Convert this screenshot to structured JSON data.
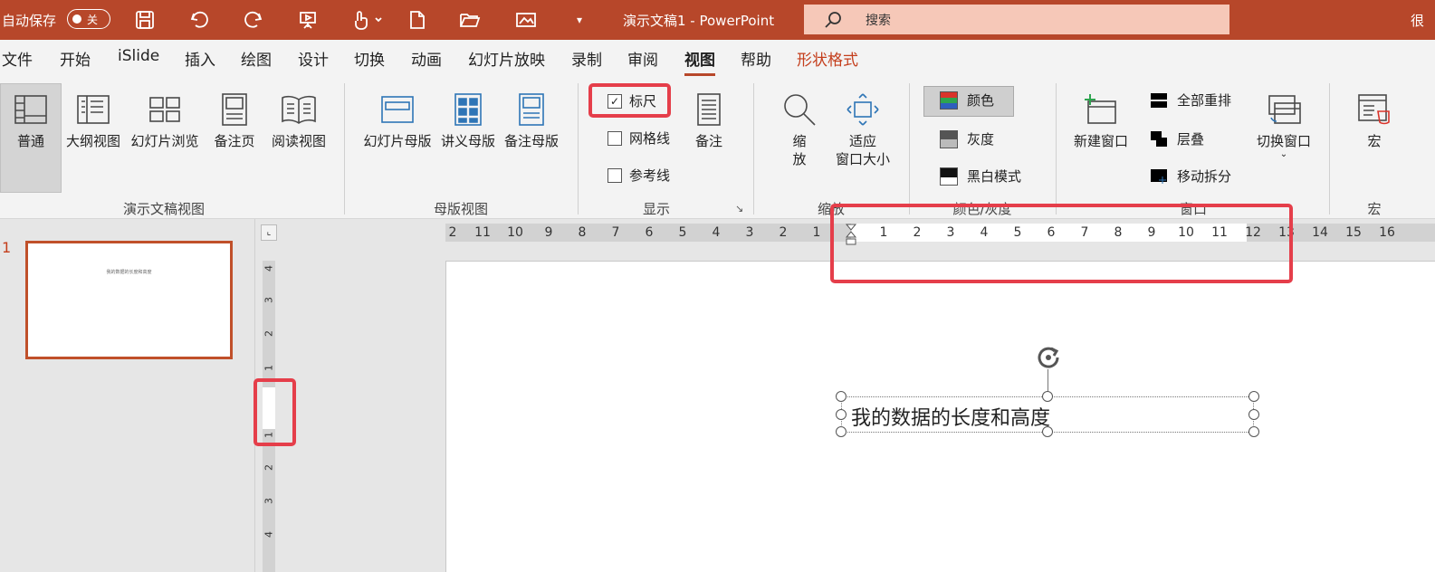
{
  "titlebar": {
    "autosave_label": "自动保存",
    "toggle_state": "关",
    "doc_title": "演示文稿1 - PowerPoint",
    "search_placeholder": "搜索",
    "overflow_char": "很"
  },
  "tabs": [
    "文件",
    "开始",
    "iSlide",
    "插入",
    "绘图",
    "设计",
    "切换",
    "动画",
    "幻灯片放映",
    "录制",
    "审阅",
    "视图",
    "帮助",
    "形状格式"
  ],
  "active_tab": "视图",
  "ribbon": {
    "views": {
      "label": "演示文稿视图",
      "buttons": [
        "普通",
        "大纲视图",
        "幻灯片浏览",
        "备注页",
        "阅读视图"
      ]
    },
    "master": {
      "label": "母版视图",
      "buttons": [
        "幻灯片母版",
        "讲义母版",
        "备注母版"
      ]
    },
    "show": {
      "label": "显示",
      "ruler": "标尺",
      "ruler_checked": true,
      "gridlines": "网格线",
      "gridlines_checked": false,
      "guides": "参考线",
      "guides_checked": false,
      "notes": "备注"
    },
    "zoom": {
      "label": "缩放",
      "zoom_line1": "缩",
      "zoom_line2": "放",
      "fit_line1": "适应",
      "fit_line2": "窗口大小"
    },
    "color": {
      "label": "颜色/灰度",
      "color": "颜色",
      "gray": "灰度",
      "bw": "黑白模式"
    },
    "window": {
      "label": "窗口",
      "new_window": "新建窗口",
      "arrange_all": "全部重排",
      "cascade": "层叠",
      "move_split": "移动拆分",
      "switch_window": "切换窗口"
    },
    "macros": {
      "label": "宏",
      "macros": "宏"
    }
  },
  "slide_panel": {
    "number": "1",
    "thumb_text": "我的数据的长度和高度"
  },
  "hruler_ticks": [
    "2",
    "11",
    "10",
    "9",
    "8",
    "7",
    "6",
    "5",
    "4",
    "3",
    "2",
    "1",
    "1",
    "2",
    "3",
    "4",
    "5",
    "6",
    "7",
    "8",
    "9",
    "10",
    "11",
    "12",
    "13",
    "14",
    "15",
    "16"
  ],
  "vruler_ticks": [
    "4",
    "3",
    "2",
    "1",
    "1",
    "2",
    "3",
    "4"
  ],
  "slide": {
    "textbox_text": "我的数据的长度和高度"
  },
  "colors": {
    "accent": "#b7472a",
    "highlight": "#e53e4a"
  }
}
